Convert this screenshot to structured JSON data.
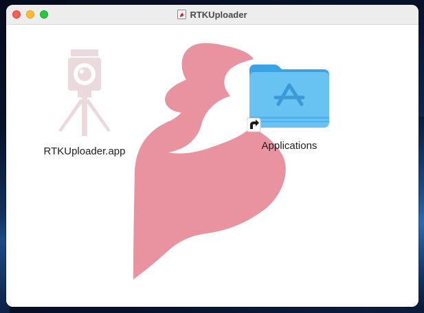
{
  "window": {
    "title": "RTKUploader",
    "controls": [
      "close",
      "minimize",
      "zoom"
    ]
  },
  "items": [
    {
      "label": "RTKUploader.app",
      "icon": "surveyor-tripod-icon"
    },
    {
      "label": "Applications",
      "icon": "applications-folder-icon",
      "alias_badge": "alias-arrow-icon"
    }
  ],
  "background_logo": "sparkfun-flame-logo",
  "colors": {
    "logo": "#e8939f",
    "folder": "#68c3f2",
    "folder_dark": "#3ba3e4",
    "titlebar": "#ededed",
    "close": "#fe5f57",
    "minimize": "#febc2e",
    "zoom": "#28c840"
  }
}
